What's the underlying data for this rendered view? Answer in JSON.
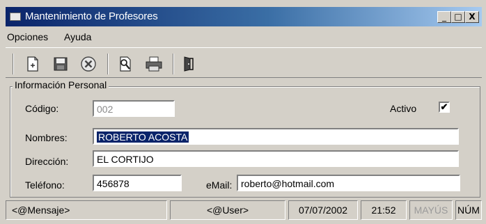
{
  "window": {
    "title": "Mantenimiento de Profesores",
    "controls": {
      "minimize": "_",
      "maximize": "□",
      "close": "X"
    }
  },
  "menu": {
    "items": [
      {
        "label": "Opciones"
      },
      {
        "label": "Ayuda"
      }
    ]
  },
  "toolbar": {
    "buttons": [
      {
        "icon": "new-document-icon"
      },
      {
        "icon": "save-icon"
      },
      {
        "icon": "cancel-icon"
      },
      {
        "icon": "search-icon"
      },
      {
        "icon": "print-icon"
      },
      {
        "icon": "exit-door-icon"
      }
    ]
  },
  "group": {
    "title": "Información Personal"
  },
  "form": {
    "codigo_label": "Código:",
    "codigo_value": "002",
    "activo_label": "Activo",
    "activo_checked": "✔",
    "nombres_label": "Nombres:",
    "nombres_value": "ROBERTO ACOSTA",
    "direccion_label": "Dirección:",
    "direccion_value": "EL CORTIJO",
    "telefono_label": "Teléfono:",
    "telefono_value": "456878",
    "email_label": "eMail:",
    "email_value": "roberto@hotmail.com"
  },
  "status": {
    "message": "<@Mensaje>",
    "user": "<@User>",
    "date": "07/07/2002",
    "time": "21:52",
    "caps": "MAYÚS",
    "num": "NÚM"
  },
  "colors": {
    "titlebar_start": "#0a246a",
    "titlebar_end": "#a6caf0",
    "window_bg": "#d4d0c8"
  }
}
